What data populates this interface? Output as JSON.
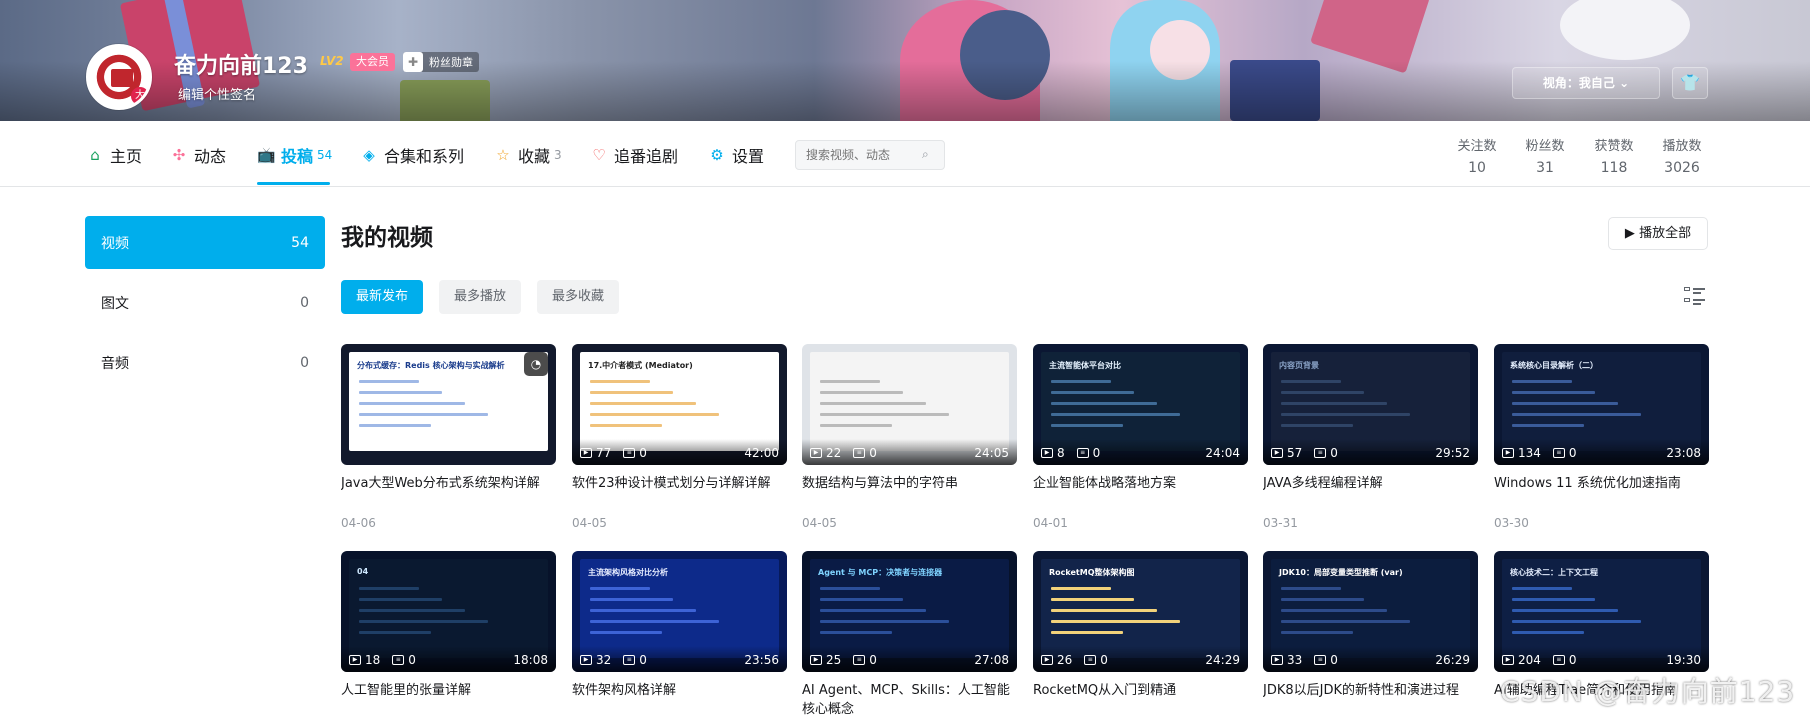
{
  "profile": {
    "name": "奋力向前123",
    "level": "LV2",
    "vip": "大会员",
    "fan_medal": "粉丝勋章",
    "signature": "编辑个性签名",
    "avatar_badge": "大",
    "view_as": "视角：我自己",
    "skin_icon": "shirt-icon"
  },
  "nav": {
    "items": [
      {
        "label": "主页",
        "icon": "home-icon"
      },
      {
        "label": "动态",
        "icon": "pinwheel-icon"
      },
      {
        "label": "投稿",
        "count": "54",
        "icon": "tv-icon"
      },
      {
        "label": "合集和系列",
        "icon": "layers-icon"
      },
      {
        "label": "收藏",
        "count": "3",
        "icon": "star-icon"
      },
      {
        "label": "追番追剧",
        "icon": "heart-icon"
      },
      {
        "label": "设置",
        "icon": "gear-icon"
      }
    ],
    "search_placeholder": "搜索视频、动态"
  },
  "stats": [
    {
      "label": "关注数",
      "value": "10"
    },
    {
      "label": "粉丝数",
      "value": "31"
    },
    {
      "label": "获赞数",
      "value": "118"
    },
    {
      "label": "播放数",
      "value": "3026"
    }
  ],
  "sidebar": {
    "items": [
      {
        "label": "视频",
        "count": "54"
      },
      {
        "label": "图文",
        "count": "0"
      },
      {
        "label": "音频",
        "count": "0"
      }
    ]
  },
  "main": {
    "title": "我的视频",
    "play_all": "播放全部",
    "sorts": [
      "最新发布",
      "最多播放",
      "最多收藏"
    ]
  },
  "videos": [
    {
      "title": "Java大型Web分布式系统架构详解",
      "date": "04-06",
      "plays": "",
      "danmaku": "",
      "duration": "",
      "thumb_title": "分布式缓存：Redis 核心架构与实战解析"
    },
    {
      "title": "软件23种设计模式划分与详解详解",
      "date": "04-05",
      "plays": "77",
      "danmaku": "0",
      "duration": "42:00",
      "thumb_title": "17.中介者模式 (Mediator)"
    },
    {
      "title": "数据结构与算法中的字符串",
      "date": "04-05",
      "plays": "22",
      "danmaku": "0",
      "duration": "24:05",
      "thumb_title": ""
    },
    {
      "title": "企业智能体战略落地方案",
      "date": "04-01",
      "plays": "8",
      "danmaku": "0",
      "duration": "24:04",
      "thumb_title": "主流智能体平台对比"
    },
    {
      "title": "JAVA多线程编程详解",
      "date": "03-31",
      "plays": "57",
      "danmaku": "0",
      "duration": "29:52",
      "thumb_title": "内容页背景"
    },
    {
      "title": "Windows 11 系统优化加速指南",
      "date": "03-30",
      "plays": "134",
      "danmaku": "0",
      "duration": "23:08",
      "thumb_title": "系统核心目录解析（二）"
    },
    {
      "title": "人工智能里的张量详解",
      "date": "",
      "plays": "18",
      "danmaku": "0",
      "duration": "18:08",
      "thumb_title": "04"
    },
    {
      "title": "软件架构风格详解",
      "date": "",
      "plays": "32",
      "danmaku": "0",
      "duration": "23:56",
      "thumb_title": "主流架构风格对比分析"
    },
    {
      "title": "AI Agent、MCP、Skills：人工智能核心概念",
      "date": "",
      "plays": "25",
      "danmaku": "0",
      "duration": "27:08",
      "thumb_title": "Agent 与 MCP：决策者与连接器"
    },
    {
      "title": "RocketMQ从入门到精通",
      "date": "",
      "plays": "26",
      "danmaku": "0",
      "duration": "24:29",
      "thumb_title": "RocketMQ整体架构图"
    },
    {
      "title": "JDK8以后JDK的新特性和演进过程",
      "date": "",
      "plays": "33",
      "danmaku": "0",
      "duration": "26:29",
      "thumb_title": "JDK10：局部变量类型推断 (var)"
    },
    {
      "title": "AI辅助编程Trae简介和使用指南",
      "date": "",
      "plays": "204",
      "danmaku": "0",
      "duration": "19:30",
      "thumb_title": "核心技术二：上下文工程"
    }
  ],
  "watermark": "CSDN @奋力向前123",
  "colors": {
    "accent": "#00aeec",
    "vip": "#fb7299"
  }
}
